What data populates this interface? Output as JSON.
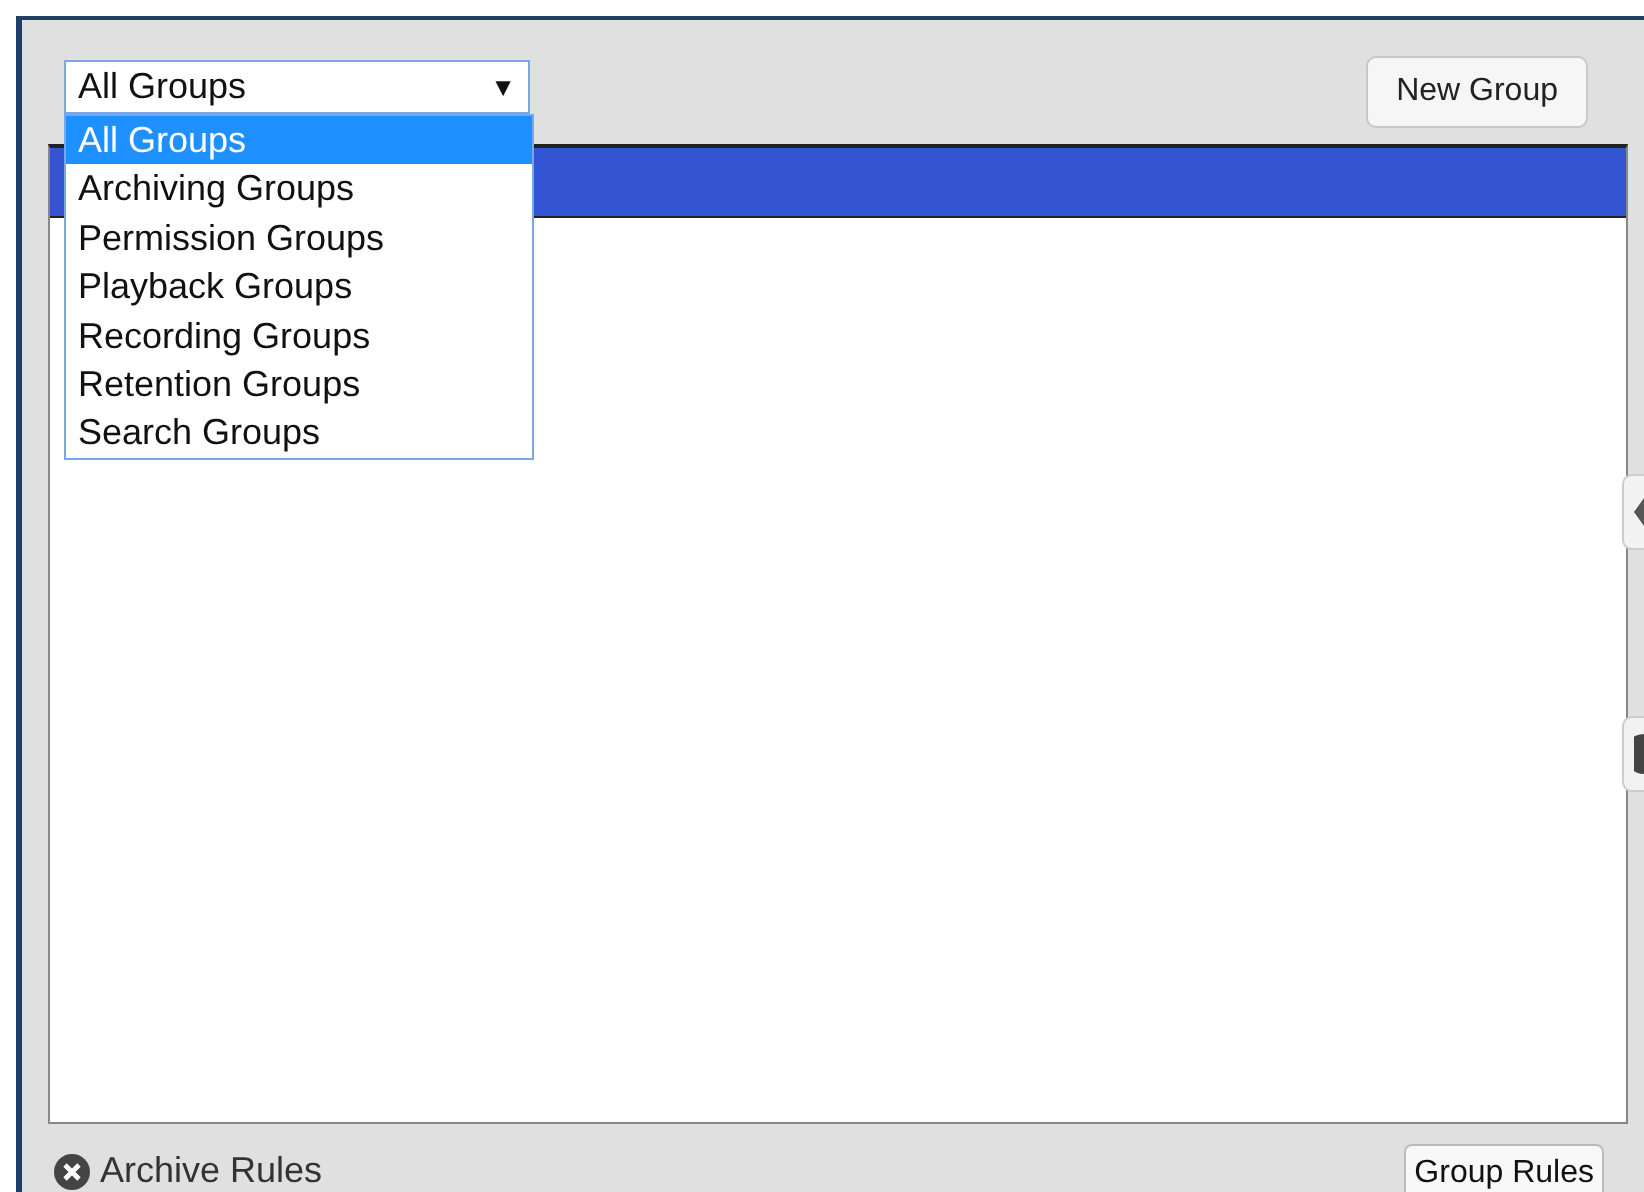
{
  "group_select": {
    "value": "All Groups",
    "arrow": "▼",
    "expanded": true,
    "options": [
      {
        "label": "All Groups",
        "selected": true
      },
      {
        "label": "Archiving Groups",
        "selected": false
      },
      {
        "label": "Permission Groups",
        "selected": false
      },
      {
        "label": "Playback Groups",
        "selected": false
      },
      {
        "label": "Recording Groups",
        "selected": false
      },
      {
        "label": "Retention Groups",
        "selected": false
      },
      {
        "label": "Search Groups",
        "selected": false
      }
    ]
  },
  "new_group_button": "New Group",
  "group_list": {
    "header_selected": true
  },
  "archive_rules": {
    "label": "Archive Rules"
  },
  "group_rules_button": "Group Rules"
}
